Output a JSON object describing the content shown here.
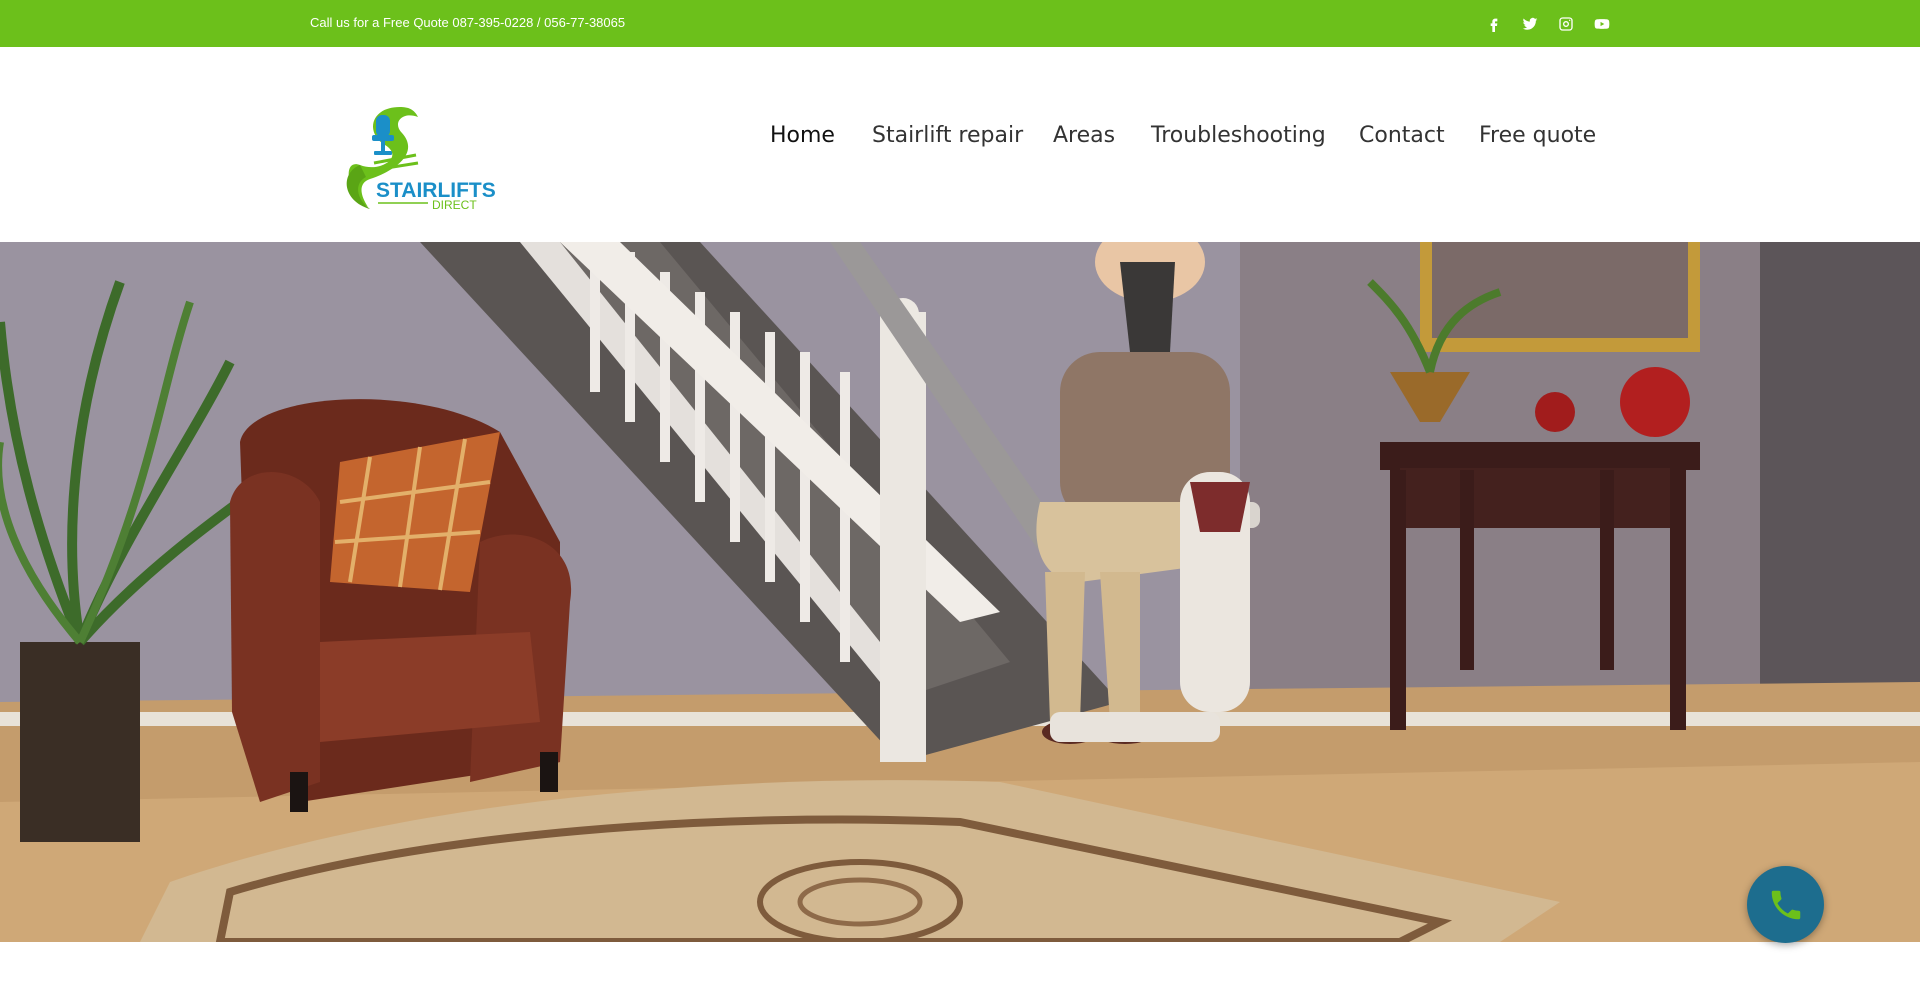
{
  "topbar": {
    "text": "Call us for a Free Quote 087-395-0228 / 056-77-38065",
    "background": "#6cc01b",
    "social_icons": [
      "facebook-icon",
      "twitter-icon",
      "instagram-icon",
      "youtube-icon"
    ]
  },
  "header": {
    "logo": {
      "line1": "STAIRLIFTS",
      "line2": "DIRECT",
      "icon": "stairlift-chair-icon"
    },
    "nav": [
      {
        "label": "Home",
        "active": true
      },
      {
        "label": "Stairlift repair"
      },
      {
        "label": "Areas"
      },
      {
        "label": "Troubleshooting"
      },
      {
        "label": "Contact"
      },
      {
        "label": "Free quote"
      }
    ]
  },
  "hero": {
    "image": "woman-on-stairlift-photo"
  },
  "call_button": {
    "icon": "phone-icon",
    "accent": "#1d6d8e"
  }
}
